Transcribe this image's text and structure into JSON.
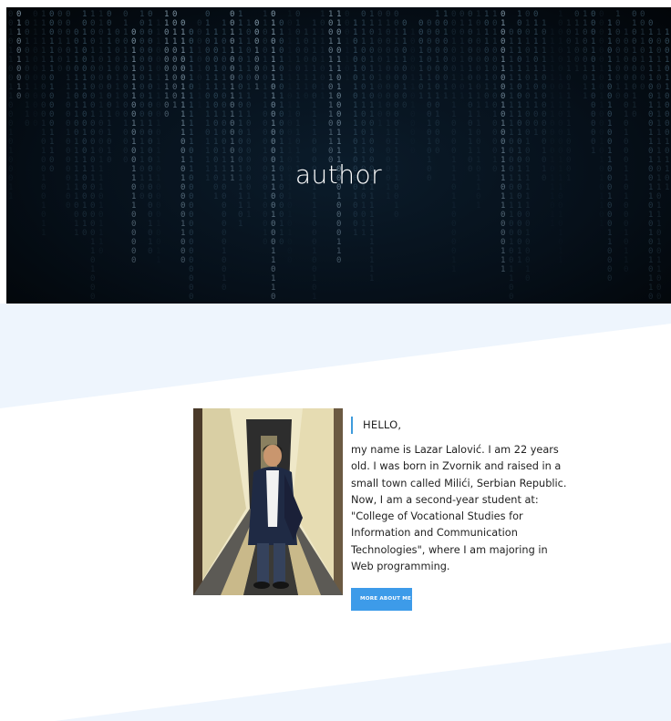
{
  "hero": {
    "title": "author"
  },
  "about": {
    "greeting": "HELLO,",
    "bio_lines": [
      "my name is Lazar Lalović. I am 22 years",
      "old. I was born in Zvornik and raised in a",
      "small town called Milići, Serbian Republic.",
      "Now, I am a second-year student at:",
      "\"College of Vocational Studies for",
      "Information and Communication",
      "Technologies\", where I am majoring in",
      "Web programming."
    ],
    "button_label": "MORE ABOUT ME"
  },
  "colors": {
    "accent": "#3d9be9",
    "band": "#eef5fd",
    "hero_dark": "#06101a"
  },
  "icons": {
    "photo": "author-photo"
  }
}
